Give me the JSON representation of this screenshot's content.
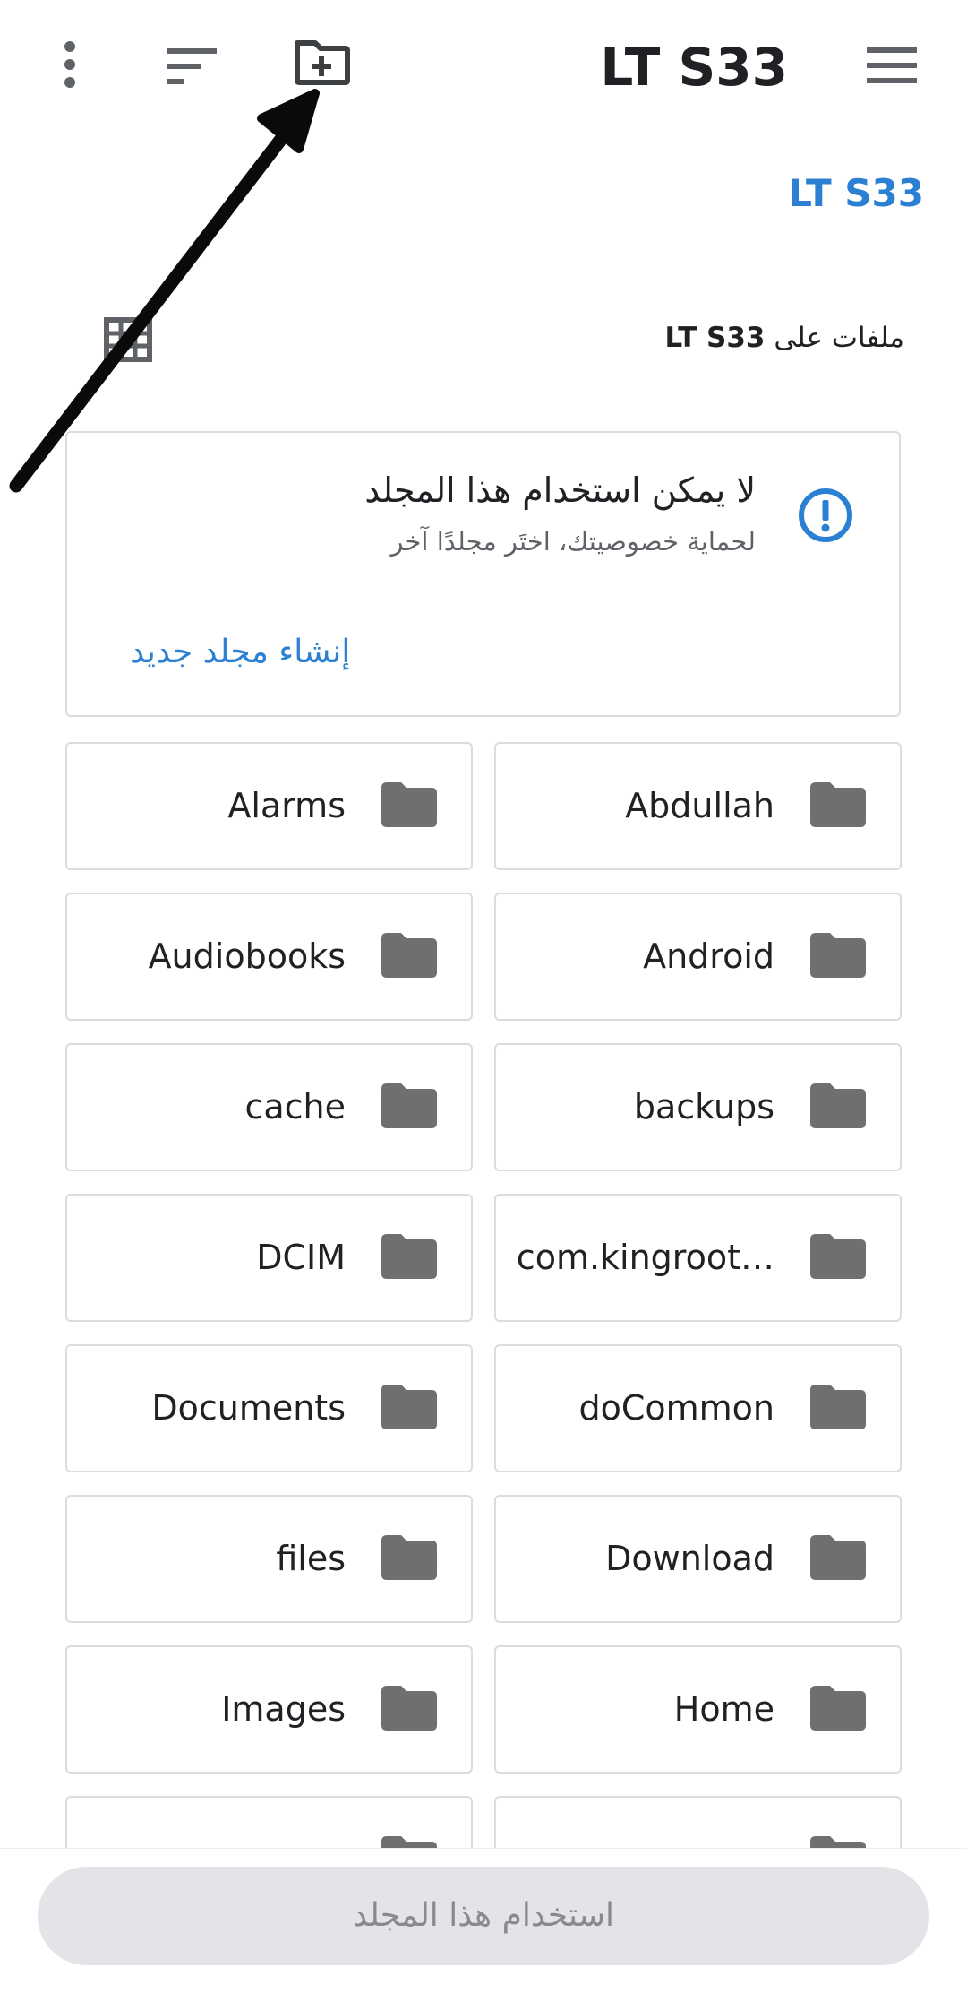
{
  "app_bar": {
    "title": "LT S33",
    "icons": [
      "more-vert-icon",
      "sort-icon",
      "new-folder-icon",
      "menu-icon"
    ]
  },
  "breadcrumb": "LT S33",
  "files_on": {
    "prefix": "ملفات على",
    "device": "LT S33"
  },
  "warning": {
    "title": "لا يمكن استخدام هذا المجلد",
    "subtitle": "لحماية خصوصيتك، اختَر مجلدًا آخر",
    "action": "إنشاء مجلد جديد",
    "icon": "info-alert-icon"
  },
  "folders": [
    {
      "name": "Abdullah"
    },
    {
      "name": "Alarms"
    },
    {
      "name": "Android"
    },
    {
      "name": "Audiobooks"
    },
    {
      "name": "backups"
    },
    {
      "name": "cache"
    },
    {
      "name": "com.kingroot…"
    },
    {
      "name": "DCIM"
    },
    {
      "name": "doCommon"
    },
    {
      "name": "Documents"
    },
    {
      "name": "Download"
    },
    {
      "name": "files"
    },
    {
      "name": "Home"
    },
    {
      "name": "Images"
    }
  ],
  "bottom_button": "استخدام هذا المجلد",
  "colors": {
    "accent": "#2b80d4",
    "folder_icon": "#6f6f6f",
    "border": "#dadce0",
    "button_disabled_bg": "#e4e4e8"
  }
}
